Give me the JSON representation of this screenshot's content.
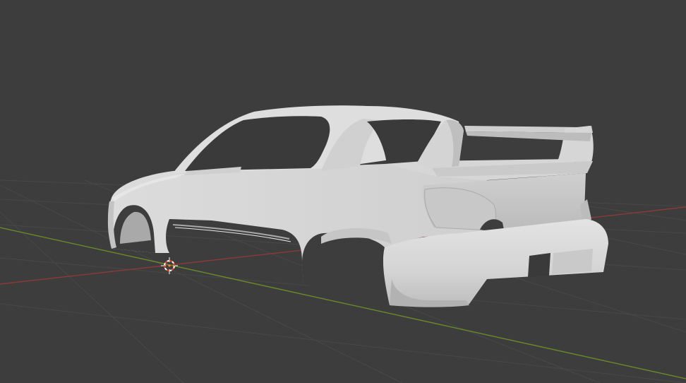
{
  "viewport": {
    "background_color": "#3d3d3d",
    "grid_line_color": "#4a4a4a",
    "x_axis_color": "#8a3a3a",
    "y_axis_color": "#6a8a2a",
    "view_type": "3d-viewport-solid-shading"
  },
  "object": {
    "type": "car-body-shell",
    "shading": "solid",
    "color": "#d9d9d9"
  },
  "cursor_3d": {
    "icon": "3d-cursor-icon",
    "ring_color_a": "#e04a2a",
    "ring_color_b": "#ffffff"
  }
}
